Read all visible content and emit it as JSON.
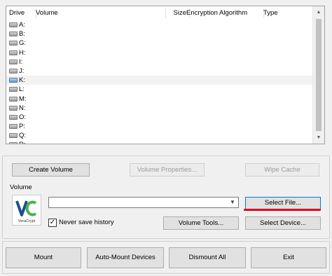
{
  "list": {
    "columns": {
      "drive": "Drive",
      "volume": "Volume",
      "size": "Size",
      "algorithm": "Encryption Algorithm",
      "type": "Type"
    },
    "drives": [
      "A:",
      "B:",
      "G:",
      "H:",
      "I:",
      "J:",
      "K:",
      "L:",
      "M:",
      "N:",
      "O:",
      "P:",
      "Q:",
      "R:"
    ],
    "selected_drive": "K:"
  },
  "buttons": {
    "create_volume": "Create Volume",
    "volume_properties": "Volume Properties...",
    "wipe_cache": "Wipe Cache",
    "select_file": "Select File...",
    "volume_tools": "Volume Tools...",
    "select_device": "Select Device...",
    "mount": "Mount",
    "auto_mount": "Auto-Mount Devices",
    "dismount_all": "Dismount All",
    "exit": "Exit"
  },
  "volume_group": {
    "label": "Volume",
    "path_value": "",
    "never_save_history": "Never save history",
    "never_save_history_checked": true
  },
  "logo": {
    "text": "VeraCrypt"
  },
  "colors": {
    "accent": "#0078d7",
    "highlight_underline": "#e3001b"
  }
}
